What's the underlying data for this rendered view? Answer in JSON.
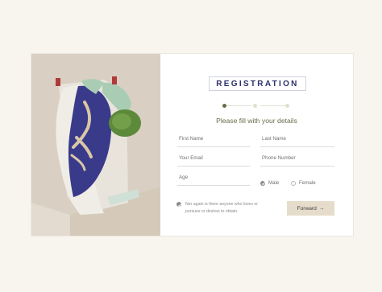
{
  "title": "REGISTRATION",
  "subtitle": "Please fill with your details",
  "fields": {
    "first_name": "First Name",
    "last_name": "Last Name",
    "email": "Your Email",
    "phone": "Phone Number",
    "age": "Age"
  },
  "gender": {
    "male": "Male",
    "female": "Female",
    "selected": "Male"
  },
  "agreement_text": "Ner again is there anyone who loves or pursues or desires to obtain.",
  "forward_label": "Forward",
  "forward_arrow": "→",
  "steps": {
    "total": 3,
    "current": 1
  },
  "colors": {
    "accent": "#2a2f6b",
    "step_active": "#6b6a46",
    "step_inactive": "#e2dfcd",
    "button_bg": "#e5dccb"
  }
}
